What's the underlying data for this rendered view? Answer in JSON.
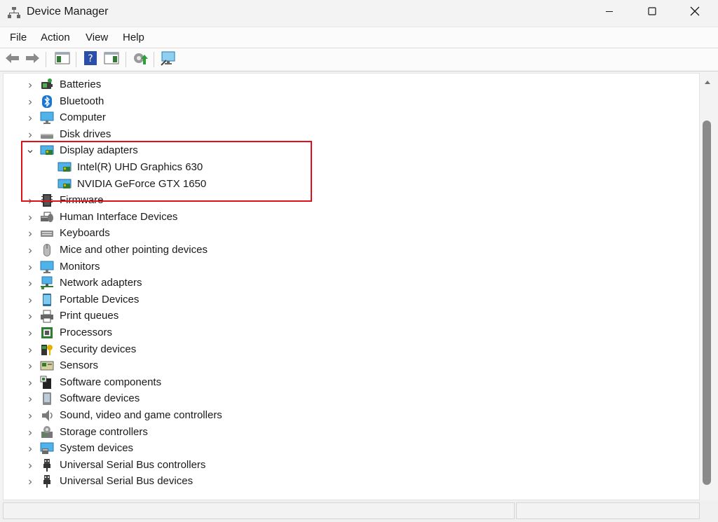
{
  "window": {
    "title": "Device Manager"
  },
  "icons": {
    "app": "device-manager-icon",
    "minimize": "minimize-icon",
    "maximize": "maximize-icon",
    "close": "close-icon"
  },
  "menu": [
    "File",
    "Action",
    "View",
    "Help"
  ],
  "toolbar": [
    "back-arrow-icon",
    "forward-arrow-icon",
    "properties-pane-icon",
    "help-icon",
    "console-tree-icon",
    "update-driver-icon",
    "scan-hardware-icon"
  ],
  "tree": [
    {
      "label": "Batteries",
      "icon": "battery-icon",
      "expanded": false
    },
    {
      "label": "Bluetooth",
      "icon": "bluetooth-icon",
      "expanded": false
    },
    {
      "label": "Computer",
      "icon": "computer-icon",
      "expanded": false
    },
    {
      "label": "Disk drives",
      "icon": "disk-drive-icon",
      "expanded": false
    },
    {
      "label": "Display adapters",
      "icon": "display-adapter-icon",
      "expanded": true,
      "children": [
        {
          "label": "Intel(R) UHD Graphics 630",
          "icon": "display-adapter-icon"
        },
        {
          "label": "NVIDIA GeForce GTX 1650",
          "icon": "display-adapter-icon"
        }
      ]
    },
    {
      "label": "Firmware",
      "icon": "firmware-icon",
      "expanded": false
    },
    {
      "label": "Human Interface Devices",
      "icon": "hid-icon",
      "expanded": false
    },
    {
      "label": "Keyboards",
      "icon": "keyboard-icon",
      "expanded": false
    },
    {
      "label": "Mice and other pointing devices",
      "icon": "mouse-icon",
      "expanded": false
    },
    {
      "label": "Monitors",
      "icon": "monitor-icon",
      "expanded": false
    },
    {
      "label": "Network adapters",
      "icon": "network-adapter-icon",
      "expanded": false
    },
    {
      "label": "Portable Devices",
      "icon": "portable-device-icon",
      "expanded": false
    },
    {
      "label": "Print queues",
      "icon": "printer-icon",
      "expanded": false
    },
    {
      "label": "Processors",
      "icon": "processor-icon",
      "expanded": false
    },
    {
      "label": "Security devices",
      "icon": "security-device-icon",
      "expanded": false
    },
    {
      "label": "Sensors",
      "icon": "sensor-icon",
      "expanded": false
    },
    {
      "label": "Software components",
      "icon": "software-component-icon",
      "expanded": false
    },
    {
      "label": "Software devices",
      "icon": "software-device-icon",
      "expanded": false
    },
    {
      "label": "Sound, video and game controllers",
      "icon": "sound-icon",
      "expanded": false
    },
    {
      "label": "Storage controllers",
      "icon": "storage-controller-icon",
      "expanded": false
    },
    {
      "label": "System devices",
      "icon": "system-device-icon",
      "expanded": false
    },
    {
      "label": "Universal Serial Bus controllers",
      "icon": "usb-icon",
      "expanded": false
    },
    {
      "label": "Universal Serial Bus devices",
      "icon": "usb-icon",
      "expanded": false
    }
  ],
  "colors": {
    "highlight": "#e0101a",
    "accent": "#0078d4"
  }
}
